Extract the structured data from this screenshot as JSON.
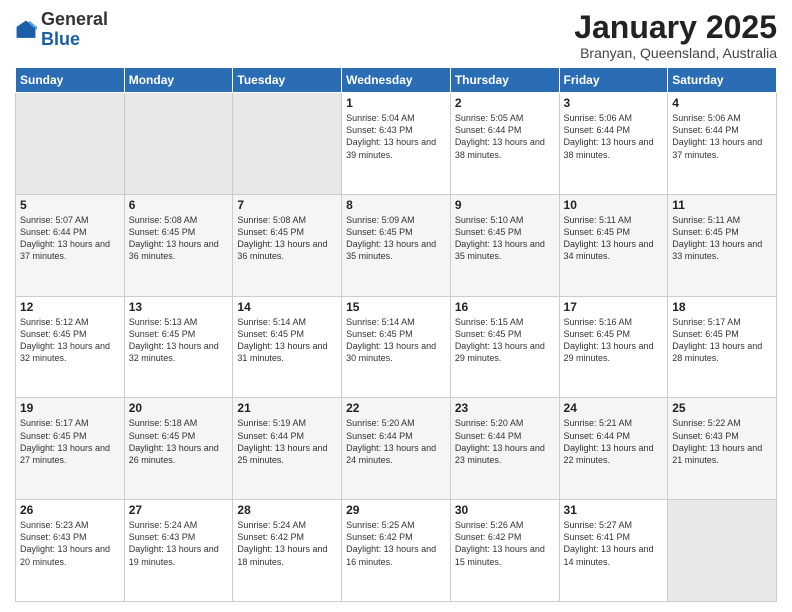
{
  "header": {
    "logo_general": "General",
    "logo_blue": "Blue",
    "title": "January 2025",
    "subtitle": "Branyan, Queensland, Australia"
  },
  "days_of_week": [
    "Sunday",
    "Monday",
    "Tuesday",
    "Wednesday",
    "Thursday",
    "Friday",
    "Saturday"
  ],
  "weeks": [
    [
      {
        "day": "",
        "info": ""
      },
      {
        "day": "",
        "info": ""
      },
      {
        "day": "",
        "info": ""
      },
      {
        "day": "1",
        "info": "Sunrise: 5:04 AM\nSunset: 6:43 PM\nDaylight: 13 hours\nand 39 minutes."
      },
      {
        "day": "2",
        "info": "Sunrise: 5:05 AM\nSunset: 6:44 PM\nDaylight: 13 hours\nand 38 minutes."
      },
      {
        "day": "3",
        "info": "Sunrise: 5:06 AM\nSunset: 6:44 PM\nDaylight: 13 hours\nand 38 minutes."
      },
      {
        "day": "4",
        "info": "Sunrise: 5:06 AM\nSunset: 6:44 PM\nDaylight: 13 hours\nand 37 minutes."
      }
    ],
    [
      {
        "day": "5",
        "info": "Sunrise: 5:07 AM\nSunset: 6:44 PM\nDaylight: 13 hours\nand 37 minutes."
      },
      {
        "day": "6",
        "info": "Sunrise: 5:08 AM\nSunset: 6:45 PM\nDaylight: 13 hours\nand 36 minutes."
      },
      {
        "day": "7",
        "info": "Sunrise: 5:08 AM\nSunset: 6:45 PM\nDaylight: 13 hours\nand 36 minutes."
      },
      {
        "day": "8",
        "info": "Sunrise: 5:09 AM\nSunset: 6:45 PM\nDaylight: 13 hours\nand 35 minutes."
      },
      {
        "day": "9",
        "info": "Sunrise: 5:10 AM\nSunset: 6:45 PM\nDaylight: 13 hours\nand 35 minutes."
      },
      {
        "day": "10",
        "info": "Sunrise: 5:11 AM\nSunset: 6:45 PM\nDaylight: 13 hours\nand 34 minutes."
      },
      {
        "day": "11",
        "info": "Sunrise: 5:11 AM\nSunset: 6:45 PM\nDaylight: 13 hours\nand 33 minutes."
      }
    ],
    [
      {
        "day": "12",
        "info": "Sunrise: 5:12 AM\nSunset: 6:45 PM\nDaylight: 13 hours\nand 32 minutes."
      },
      {
        "day": "13",
        "info": "Sunrise: 5:13 AM\nSunset: 6:45 PM\nDaylight: 13 hours\nand 32 minutes."
      },
      {
        "day": "14",
        "info": "Sunrise: 5:14 AM\nSunset: 6:45 PM\nDaylight: 13 hours\nand 31 minutes."
      },
      {
        "day": "15",
        "info": "Sunrise: 5:14 AM\nSunset: 6:45 PM\nDaylight: 13 hours\nand 30 minutes."
      },
      {
        "day": "16",
        "info": "Sunrise: 5:15 AM\nSunset: 6:45 PM\nDaylight: 13 hours\nand 29 minutes."
      },
      {
        "day": "17",
        "info": "Sunrise: 5:16 AM\nSunset: 6:45 PM\nDaylight: 13 hours\nand 29 minutes."
      },
      {
        "day": "18",
        "info": "Sunrise: 5:17 AM\nSunset: 6:45 PM\nDaylight: 13 hours\nand 28 minutes."
      }
    ],
    [
      {
        "day": "19",
        "info": "Sunrise: 5:17 AM\nSunset: 6:45 PM\nDaylight: 13 hours\nand 27 minutes."
      },
      {
        "day": "20",
        "info": "Sunrise: 5:18 AM\nSunset: 6:45 PM\nDaylight: 13 hours\nand 26 minutes."
      },
      {
        "day": "21",
        "info": "Sunrise: 5:19 AM\nSunset: 6:44 PM\nDaylight: 13 hours\nand 25 minutes."
      },
      {
        "day": "22",
        "info": "Sunrise: 5:20 AM\nSunset: 6:44 PM\nDaylight: 13 hours\nand 24 minutes."
      },
      {
        "day": "23",
        "info": "Sunrise: 5:20 AM\nSunset: 6:44 PM\nDaylight: 13 hours\nand 23 minutes."
      },
      {
        "day": "24",
        "info": "Sunrise: 5:21 AM\nSunset: 6:44 PM\nDaylight: 13 hours\nand 22 minutes."
      },
      {
        "day": "25",
        "info": "Sunrise: 5:22 AM\nSunset: 6:43 PM\nDaylight: 13 hours\nand 21 minutes."
      }
    ],
    [
      {
        "day": "26",
        "info": "Sunrise: 5:23 AM\nSunset: 6:43 PM\nDaylight: 13 hours\nand 20 minutes."
      },
      {
        "day": "27",
        "info": "Sunrise: 5:24 AM\nSunset: 6:43 PM\nDaylight: 13 hours\nand 19 minutes."
      },
      {
        "day": "28",
        "info": "Sunrise: 5:24 AM\nSunset: 6:42 PM\nDaylight: 13 hours\nand 18 minutes."
      },
      {
        "day": "29",
        "info": "Sunrise: 5:25 AM\nSunset: 6:42 PM\nDaylight: 13 hours\nand 16 minutes."
      },
      {
        "day": "30",
        "info": "Sunrise: 5:26 AM\nSunset: 6:42 PM\nDaylight: 13 hours\nand 15 minutes."
      },
      {
        "day": "31",
        "info": "Sunrise: 5:27 AM\nSunset: 6:41 PM\nDaylight: 13 hours\nand 14 minutes."
      },
      {
        "day": "",
        "info": ""
      }
    ]
  ]
}
